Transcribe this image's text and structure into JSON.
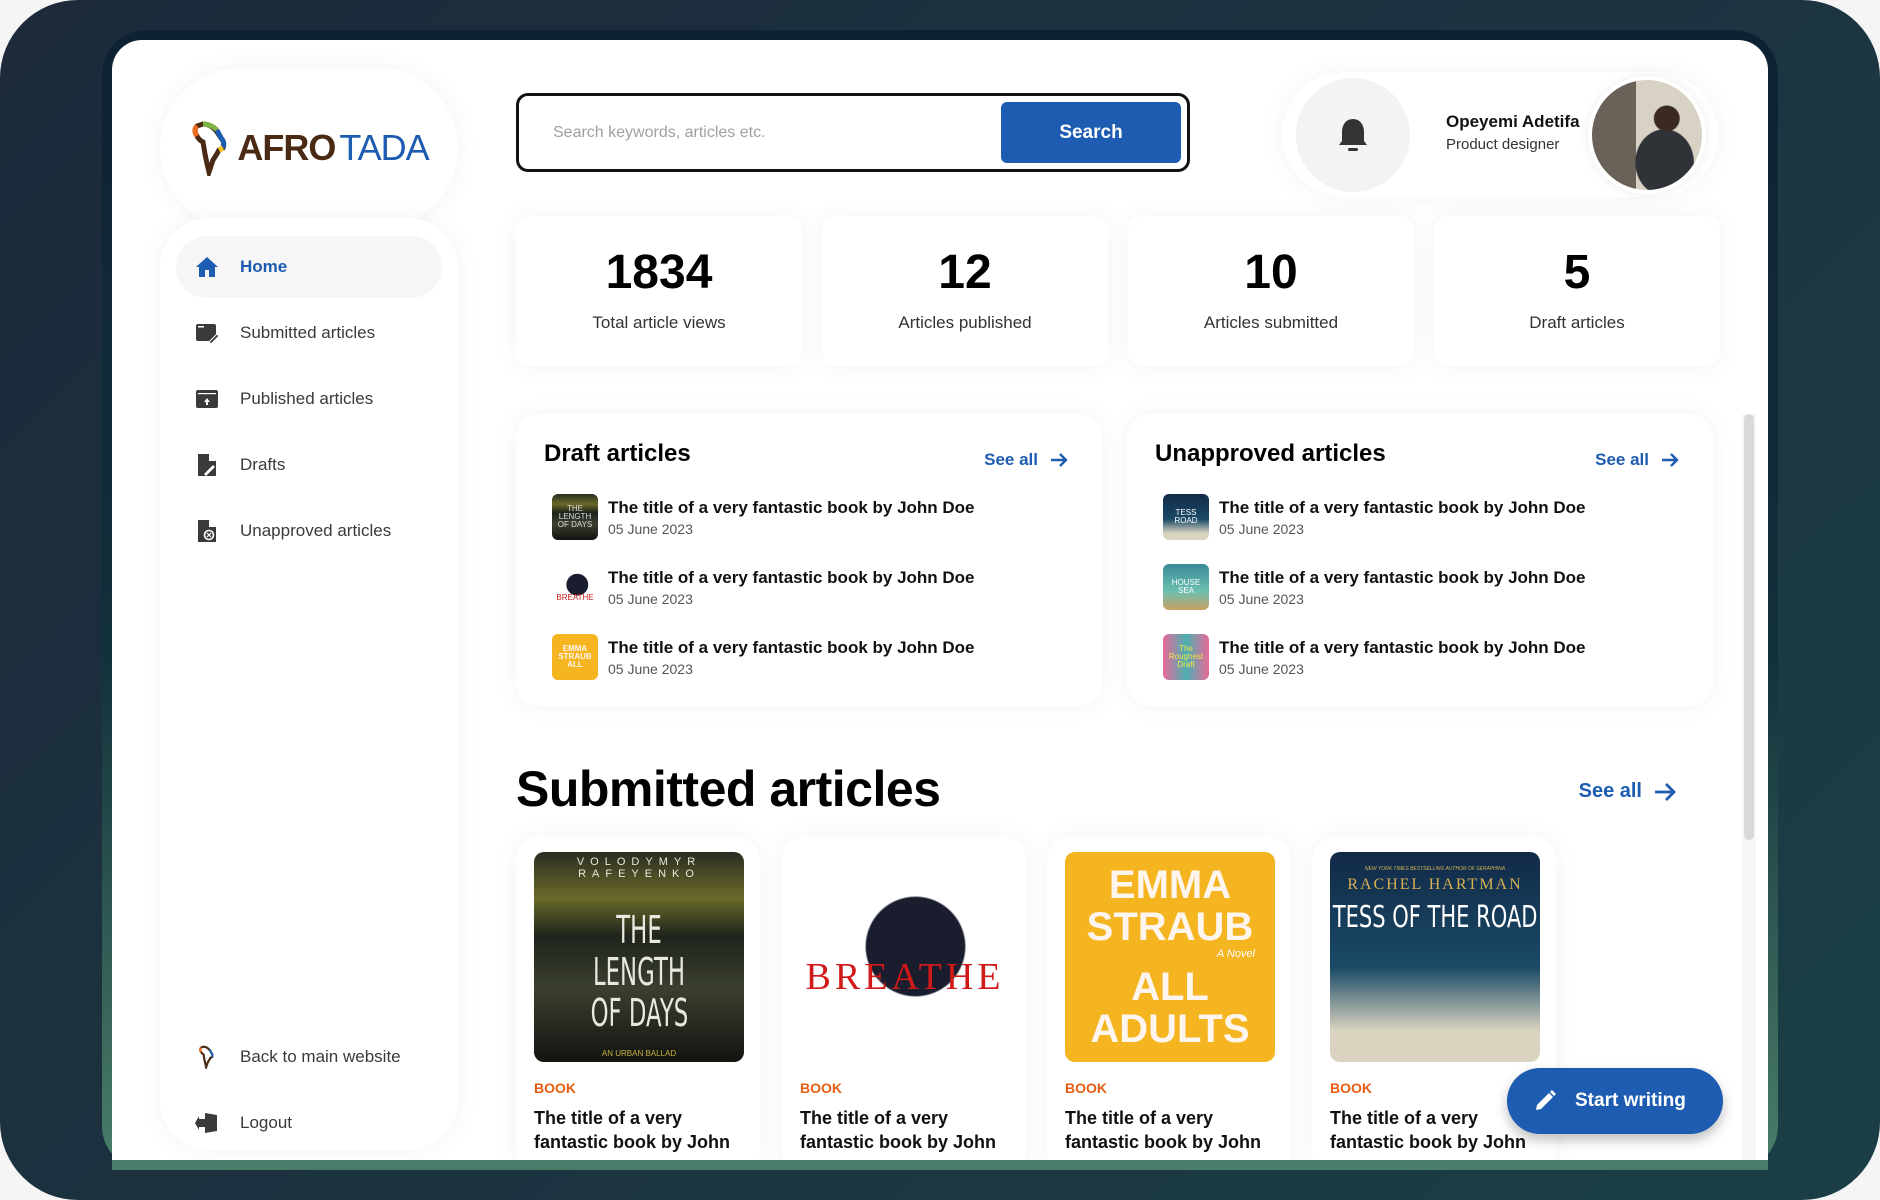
{
  "brand": {
    "name_part1": "AFRO",
    "name_part2": "TADA"
  },
  "search": {
    "placeholder": "Search keywords, articles etc.",
    "value": "",
    "button_label": "Search"
  },
  "user": {
    "name": "Opeyemi Adetifa",
    "role": "Product designer",
    "notification_icon": "bell-icon"
  },
  "sidebar": {
    "items": [
      {
        "label": "Home",
        "icon": "home-icon",
        "active": true
      },
      {
        "label": "Submitted articles",
        "icon": "submitted-articles-icon"
      },
      {
        "label": "Published articles",
        "icon": "published-articles-icon"
      },
      {
        "label": "Drafts",
        "icon": "drafts-icon"
      },
      {
        "label": "Unapproved articles",
        "icon": "unapproved-articles-icon"
      }
    ],
    "footer": [
      {
        "label": "Back to main website",
        "icon": "afro-tada-logo-icon"
      },
      {
        "label": "Logout",
        "icon": "logout-icon"
      }
    ]
  },
  "stats": [
    {
      "value": "1834",
      "label": "Total article views"
    },
    {
      "value": "12",
      "label": "Articles published"
    },
    {
      "value": "10",
      "label": "Articles submitted"
    },
    {
      "value": "5",
      "label": "Draft articles"
    }
  ],
  "draft_panel": {
    "title": "Draft articles",
    "see_all": "See all",
    "items": [
      {
        "title": "The title of  a very fantastic book by John Doe",
        "date": "05 June 2023",
        "cover": "The Length of Days"
      },
      {
        "title": "The title of  a very fantastic book by John Doe",
        "date": "05 June 2023",
        "cover": "Breathe"
      },
      {
        "title": "The title of  a very fantastic book by John Doe",
        "date": "05 June 2023",
        "cover": "Emma Straub All Adults"
      }
    ]
  },
  "unapproved_panel": {
    "title": "Unapproved articles",
    "see_all": "See all",
    "items": [
      {
        "title": "The title of  a very fantastic book by John Doe",
        "date": "05 June 2023",
        "cover": "Tess of the Road"
      },
      {
        "title": "The title of  a very fantastic book by John Doe",
        "date": "05 June 2023",
        "cover": "The House in the Cerulean Sea"
      },
      {
        "title": "The title of  a very fantastic book by John Doe",
        "date": "05 June 2023",
        "cover": "The Roughest Draft"
      }
    ]
  },
  "submitted": {
    "title": "Submitted articles",
    "see_all": "See all",
    "cards": [
      {
        "tag": "BOOK",
        "title": "The title of  a very fantastic book by John",
        "cover_author": "VOLODYMYR RAFEYENKO",
        "cover_title_1": "THE LENGTH",
        "cover_title_2": "OF DAYS",
        "cover_sub": "AN URBAN BALLAD"
      },
      {
        "tag": "BOOK",
        "title": "The title of  a very fantastic book by John",
        "cover_title_1": "BREATHE"
      },
      {
        "tag": "BOOK",
        "title": "The title of  a very fantastic book by John",
        "cover_author": "EMMA STRAUB",
        "cover_sub": "A Novel",
        "cover_title_1": "ALL",
        "cover_title_2": "ADULTS"
      },
      {
        "tag": "BOOK",
        "title": "The title of  a very fantastic book by John",
        "cover_blurb": "NEW YORK TIMES BESTSELLING AUTHOR OF SERAPHINA",
        "cover_author": "RACHEL HARTMAN",
        "cover_title_1": "TESS OF THE ROAD"
      }
    ]
  },
  "fab": {
    "label": "Start writing",
    "icon": "pencil-icon"
  },
  "colors": {
    "primary": "#1d5cb0",
    "tag": "#e85d12",
    "text": "#111111"
  }
}
